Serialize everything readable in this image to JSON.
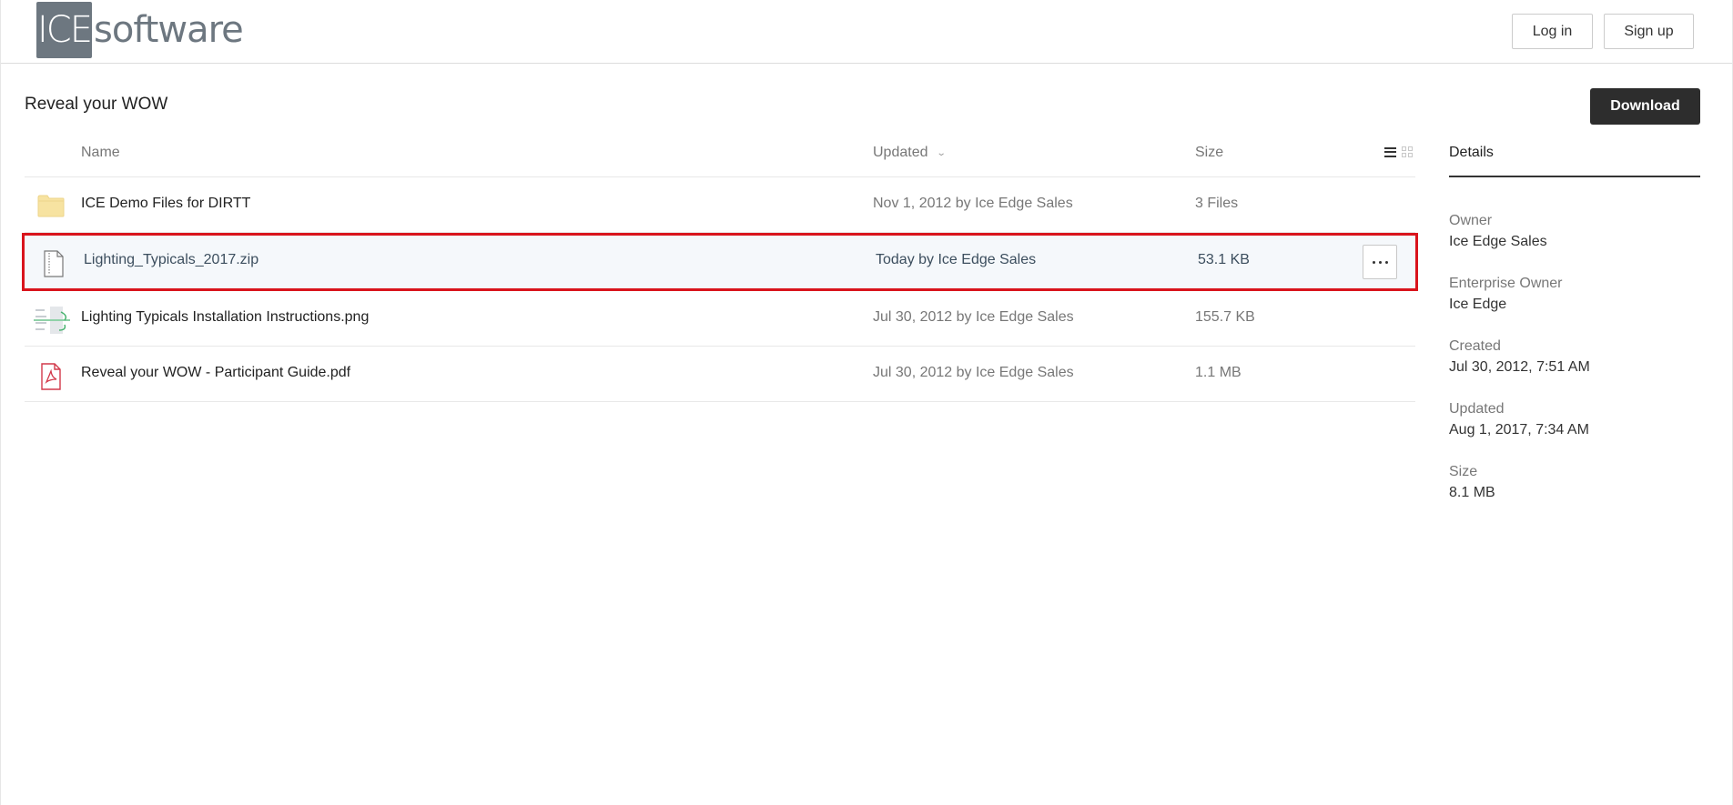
{
  "header": {
    "logo": {
      "box_text": "ICE",
      "text": "software"
    },
    "login_label": "Log in",
    "signup_label": "Sign up"
  },
  "page": {
    "title": "Reveal your WOW",
    "download_label": "Download"
  },
  "list": {
    "columns": {
      "name": "Name",
      "updated": "Updated",
      "updated_sort_icon": "chevron-down-icon",
      "size": "Size"
    },
    "view_toggle": {
      "list_icon": "list-view-icon",
      "grid_icon": "grid-view-icon",
      "active": "list"
    },
    "rows": [
      {
        "icon": "folder-icon",
        "name": "ICE Demo Files for DIRTT",
        "updated": "Nov 1, 2012 by Ice Edge Sales",
        "size": "3 Files",
        "selected": false
      },
      {
        "icon": "zip-file-icon",
        "name": "Lighting_Typicals_2017.zip",
        "updated": "Today by Ice Edge Sales",
        "size": "53.1 KB",
        "selected": true,
        "more_icon": "more-options-icon"
      },
      {
        "icon": "image-thumbnail-icon",
        "name": "Lighting Typicals Installation Instructions.png",
        "updated": "Jul 30, 2012 by Ice Edge Sales",
        "size": "155.7 KB",
        "selected": false
      },
      {
        "icon": "pdf-file-icon",
        "name": "Reveal your WOW - Participant Guide.pdf",
        "updated": "Jul 30, 2012 by Ice Edge Sales",
        "size": "1.1 MB",
        "selected": false
      }
    ]
  },
  "details": {
    "tab_label": "Details",
    "items": [
      {
        "label": "Owner",
        "value": "Ice Edge Sales"
      },
      {
        "label": "Enterprise Owner",
        "value": "Ice Edge"
      },
      {
        "label": "Created",
        "value": "Jul 30, 2012, 7:51 AM"
      },
      {
        "label": "Updated",
        "value": "Aug 1, 2017, 7:34 AM"
      },
      {
        "label": "Size",
        "value": "8.1 MB"
      }
    ]
  },
  "colors": {
    "selection_border": "#d9141c",
    "selection_bg": "#f5f8fb",
    "download_bg": "#2d2d2d",
    "logo_gray": "#6d7780",
    "folder_yellow": "#f7e3a1",
    "pdf_red": "#d2394a"
  }
}
